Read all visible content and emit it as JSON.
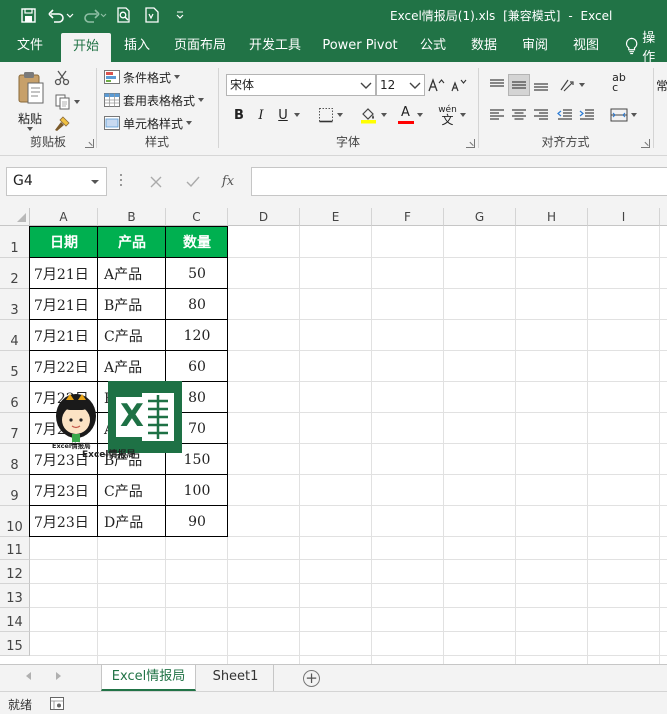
{
  "titlebar": {
    "filename": "Excel情报局(1).xls",
    "mode": "[兼容模式]",
    "separator": "-",
    "app": "Excel"
  },
  "tabs": [
    "文件",
    "开始",
    "插入",
    "页面布局",
    "开发工具",
    "Power Pivot",
    "公式",
    "数据",
    "审阅",
    "视图"
  ],
  "active_tab": "开始",
  "tell_me": "操作",
  "ribbon": {
    "clipboard": {
      "paste_label": "粘贴",
      "group_label": "剪贴板"
    },
    "styles": {
      "conditional": "条件格式",
      "table": "套用表格格式",
      "cell": "单元格样式",
      "group_label": "样式"
    },
    "font": {
      "name": "宋体",
      "size": "12",
      "bold": "B",
      "italic": "I",
      "underline": "U",
      "font_color_letter": "A",
      "phonetic": "wén",
      "group_label": "字体"
    },
    "alignment": {
      "group_label": "对齐方式",
      "wrap_abbr": "ab",
      "wrap_abbr2": "c"
    }
  },
  "formula_bar": {
    "name_box": "G4",
    "fx": "fx",
    "value": ""
  },
  "grid": {
    "columns": [
      "A",
      "B",
      "C",
      "D",
      "E",
      "F",
      "G",
      "H",
      "I"
    ],
    "rows": [
      "1",
      "2",
      "3",
      "4",
      "5",
      "6",
      "7",
      "8",
      "9",
      "10",
      "11",
      "12",
      "13",
      "14",
      "15"
    ],
    "header": [
      "日期",
      "产品",
      "数量"
    ],
    "data": [
      [
        "7月21日",
        "A产品",
        "50"
      ],
      [
        "7月21日",
        "B产品",
        "80"
      ],
      [
        "7月21日",
        "C产品",
        "120"
      ],
      [
        "7月22日",
        "A产品",
        "60"
      ],
      [
        "7月22日",
        "B产品",
        "80"
      ],
      [
        "7月23日",
        "A产品",
        "70"
      ],
      [
        "7月23日",
        "B产品",
        "150"
      ],
      [
        "7月23日",
        "C产品",
        "100"
      ],
      [
        "7月23日",
        "D产品",
        "90"
      ]
    ],
    "header_color": "#00b050"
  },
  "logo": {
    "doll_caption": "Excel情报局",
    "caption": "Excel情报局",
    "x_letter": "X"
  },
  "sheets": [
    "Excel情报局",
    "Sheet1"
  ],
  "active_sheet": "Excel情报局",
  "status": {
    "text": "就绪"
  },
  "colors": {
    "brand": "#217346",
    "header_fill": "#00b050"
  }
}
